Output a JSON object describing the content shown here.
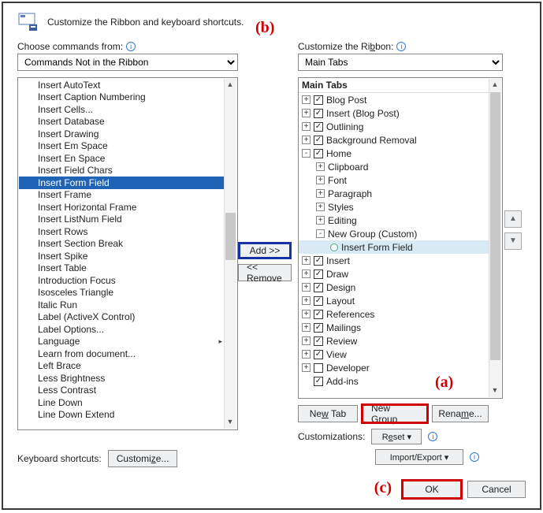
{
  "header": {
    "title": "Customize the Ribbon and keyboard shortcuts."
  },
  "leftPanel": {
    "label": "Choose commands from:",
    "dropdown": "Commands Not in the Ribbon",
    "items": [
      "Insert AutoText",
      "Insert Caption Numbering",
      "Insert Cells...",
      "Insert Database",
      "Insert Drawing",
      "Insert Em Space",
      "Insert En Space",
      "Insert Field Chars",
      "Insert Form Field",
      "Insert Frame",
      "Insert Horizontal Frame",
      "Insert ListNum Field",
      "Insert Rows",
      "Insert Section Break",
      "Insert Spike",
      "Insert Table",
      "Introduction Focus",
      "Isosceles Triangle",
      "Italic Run",
      "Label (ActiveX Control)",
      "Label Options...",
      "Language",
      "Learn from document...",
      "Left Brace",
      "Less Brightness",
      "Less Contrast",
      "Line Down",
      "Line Down Extend"
    ],
    "selectedIndex": 8
  },
  "midButtons": {
    "add": "Add >>",
    "remove": "<< Remove"
  },
  "rightPanel": {
    "label": "Customize the Ribbon:",
    "dropdown": "Main Tabs",
    "treeHeader": "Main Tabs",
    "nodes": [
      {
        "d": 0,
        "exp": "+",
        "chk": true,
        "label": "Blog Post"
      },
      {
        "d": 0,
        "exp": "+",
        "chk": true,
        "label": "Insert (Blog Post)"
      },
      {
        "d": 0,
        "exp": "+",
        "chk": true,
        "label": "Outlining"
      },
      {
        "d": 0,
        "exp": "+",
        "chk": true,
        "label": "Background Removal"
      },
      {
        "d": 0,
        "exp": "-",
        "chk": true,
        "label": "Home"
      },
      {
        "d": 1,
        "exp": "+",
        "label": "Clipboard"
      },
      {
        "d": 1,
        "exp": "+",
        "label": "Font"
      },
      {
        "d": 1,
        "exp": "+",
        "label": "Paragraph"
      },
      {
        "d": 1,
        "exp": "+",
        "label": "Styles"
      },
      {
        "d": 1,
        "exp": "+",
        "label": "Editing"
      },
      {
        "d": 1,
        "exp": "-",
        "label": "New Group (Custom)"
      },
      {
        "d": 2,
        "circle": true,
        "label": "Insert Form Field",
        "sel": true
      },
      {
        "d": 0,
        "exp": "+",
        "chk": true,
        "label": "Insert"
      },
      {
        "d": 0,
        "exp": "+",
        "chk": true,
        "label": "Draw"
      },
      {
        "d": 0,
        "exp": "+",
        "chk": true,
        "label": "Design"
      },
      {
        "d": 0,
        "exp": "+",
        "chk": true,
        "label": "Layout"
      },
      {
        "d": 0,
        "exp": "+",
        "chk": true,
        "label": "References"
      },
      {
        "d": 0,
        "exp": "+",
        "chk": true,
        "label": "Mailings"
      },
      {
        "d": 0,
        "exp": "+",
        "chk": true,
        "label": "Review"
      },
      {
        "d": 0,
        "exp": "+",
        "chk": true,
        "label": "View"
      },
      {
        "d": 0,
        "exp": "+",
        "chk": false,
        "label": "Developer"
      },
      {
        "d": 0,
        "chk": true,
        "label": "Add-ins"
      }
    ],
    "newTab": "New Tab",
    "newGroup": "New Group",
    "rename": "Rename...",
    "customizationsLabel": "Customizations:",
    "reset": "Reset ▾",
    "importExport": "Import/Export ▾"
  },
  "keyboard": {
    "label": "Keyboard shortcuts:",
    "button": "Customize..."
  },
  "footer": {
    "ok": "OK",
    "cancel": "Cancel"
  },
  "callouts": {
    "a": "(a)",
    "b": "(b)",
    "c": "(c)"
  }
}
